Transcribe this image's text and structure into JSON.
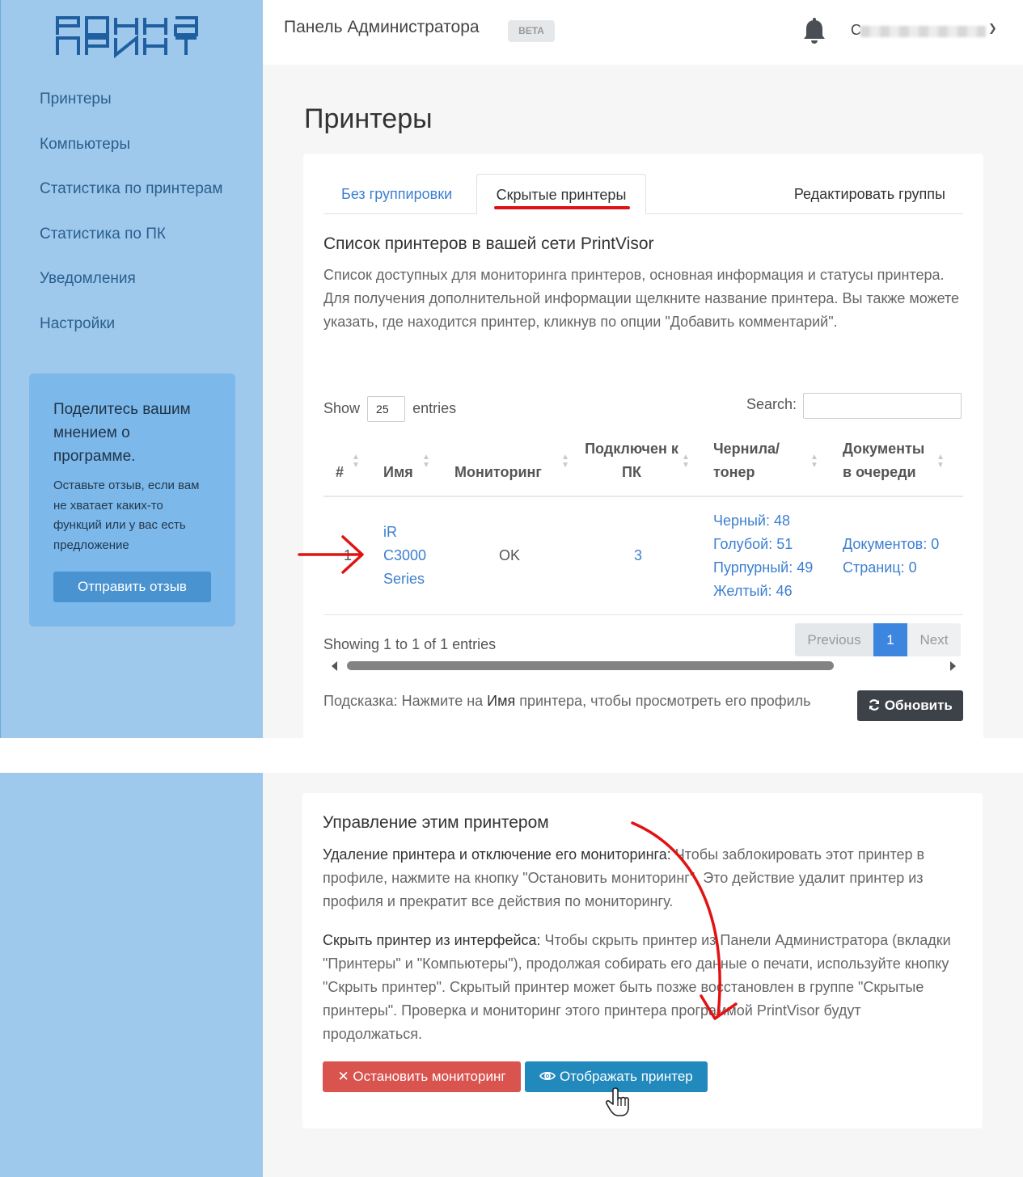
{
  "header": {
    "title": "Панель Администратора",
    "beta": "BETA",
    "user_initial": "С",
    "bell_icon": "bell-icon"
  },
  "sidebar": {
    "logo": "РОННА ПРИНТ",
    "items": [
      {
        "label": "Принтеры"
      },
      {
        "label": "Компьютеры"
      },
      {
        "label": "Статистика по принтерам"
      },
      {
        "label": "Статистика по ПК"
      },
      {
        "label": "Уведомления"
      },
      {
        "label": "Настройки"
      }
    ],
    "feedback": {
      "title": "Поделитесь вашим мнением о программе.",
      "text": "Оставьте отзыв, если вам не хватает каких-то функций или у вас есть предложение",
      "button": "Отправить отзыв"
    }
  },
  "page": {
    "title": "Принтеры",
    "tabs": [
      {
        "label": "Без группировки"
      },
      {
        "label": "Скрытые принтеры"
      },
      {
        "label": "Редактировать группы"
      }
    ],
    "section_title": "Список принтеров в вашей сети PrintVisor",
    "section_desc": "Список доступных для мониторинга принтеров, основная информация и статусы принтера. Для получения дополнительной информации щелкните название принтера. Вы также можете указать, где находится принтер, кликнув по опции \"Добавить комментарий\".",
    "show_label": "Show",
    "show_value": "25",
    "entries_label": "entries",
    "search_label": "Search:",
    "columns": [
      {
        "label": "#"
      },
      {
        "label": "Имя"
      },
      {
        "label": "Мониторинг"
      },
      {
        "label": "Подключен к ПК"
      },
      {
        "label": "Чернила/ тонер"
      },
      {
        "label": "Документы в очереди"
      }
    ],
    "rows": [
      {
        "num": "1",
        "name": "iR C3000 Series",
        "monitoring": "OK",
        "pcs": "3",
        "ink": [
          "Черный: 48",
          "Голубой: 51",
          "Пурпурный: 49",
          "Желтый: 46"
        ],
        "queue": [
          "Документов: 0",
          "Страниц: 0"
        ]
      }
    ],
    "showing": "Showing 1 to 1 of 1 entries",
    "pager": {
      "previous": "Previous",
      "current": "1",
      "next": "Next"
    },
    "hint_prefix": "Подсказка: Нажмите на ",
    "hint_bold": "Имя",
    "hint_suffix": " принтера, чтобы просмотреть его профиль",
    "refresh": "Обновить"
  },
  "manage": {
    "title": "Управление этим принтером",
    "p1_bold": "Удаление принтера и отключение его мониторинга:",
    "p1_text": " Чтобы заблокировать этот принтер в профиле, нажмите на кнопку \"Остановить мониторинг\". Это действие удалит принтер из профиля и прекратит все действия по мониторингу.",
    "p2_bold": "Скрыть принтер из интерфейса:",
    "p2_text": " Чтобы скрыть принтер из Панели Администратора (вкладки \"Принтеры\" и \"Компьютеры\"), продолжая собирать его данные о печати, используйте кнопку \"Скрыть принтер\". Скрытый принтер может быть позже восстановлен в группе \"Скрытые принтеры\". Проверка и мониторинг этого принтера программой PrintVisor будут продолжаться.",
    "stop_button": "Остановить мониторинг",
    "show_button": "Отображать принтер"
  },
  "colors": {
    "sidebar": "#9ec9ec",
    "link": "#3c7fd0",
    "annotation": "#e21212",
    "danger": "#d9534f",
    "info": "#2289bd",
    "dark": "#3d4248"
  }
}
